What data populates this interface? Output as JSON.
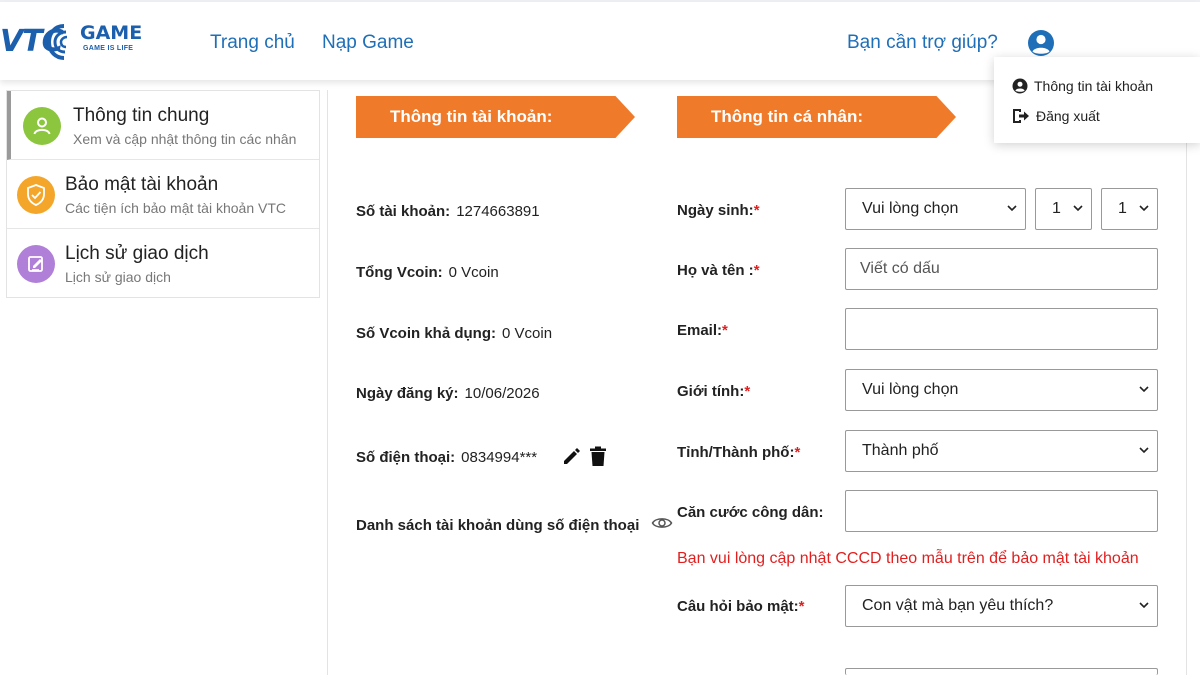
{
  "header": {
    "logo": {
      "brand": "VTC",
      "game": "GAME",
      "slogan": "GAME IS LIFE"
    },
    "nav": [
      {
        "label": "Trang chủ"
      },
      {
        "label": "Nạp Game"
      }
    ],
    "help_label": "Bạn cần trợ giúp?"
  },
  "dropdown": {
    "items": [
      {
        "label": "Thông tin tài khoản",
        "icon": "user-circle-icon"
      },
      {
        "label": "Đăng xuất",
        "icon": "logout-icon"
      }
    ]
  },
  "sidebar": {
    "items": [
      {
        "title": "Thông tin chung",
        "subtitle": "Xem và cập nhật thông tin các nhân",
        "icon": "user-icon",
        "color": "#8cc63f"
      },
      {
        "title": "Bảo mật tài khoản",
        "subtitle": "Các tiện ích bảo mật tài khoản VTC",
        "icon": "shield-check-icon",
        "color": "#f4a62a"
      },
      {
        "title": "Lịch sử giao dịch",
        "subtitle": "Lịch sử giao dịch",
        "icon": "edit-note-icon",
        "color": "#b07fd8"
      }
    ]
  },
  "account": {
    "heading": "Thông tin tài khoản:",
    "fields": [
      {
        "label": "Số tài khoản:",
        "value": "1274663891"
      },
      {
        "label": "Tổng Vcoin:",
        "value": "0 Vcoin"
      },
      {
        "label": "Số Vcoin khả dụng:",
        "value": "0 Vcoin"
      },
      {
        "label": "Ngày đăng ký:",
        "value": "10/06/2026"
      },
      {
        "label": "Số điện thoại:",
        "value": "0834994***"
      }
    ],
    "phone_accounts_label": "Danh sách tài khoản dùng số điện thoại"
  },
  "personal": {
    "heading": "Thông tin cá nhân:",
    "birthday": {
      "label": "Ngày sinh:",
      "select": "Vui lòng chọn",
      "day": "1",
      "month": "1"
    },
    "fullname": {
      "label": "Họ và tên :",
      "placeholder": "Viết có dấu"
    },
    "email": {
      "label": "Email:",
      "value": ""
    },
    "gender": {
      "label": "Giới tính:",
      "select": "Vui lòng chọn"
    },
    "city": {
      "label": "Tỉnh/Thành phố:",
      "select": "Thành phố"
    },
    "id_card": {
      "label": "Căn cước công dân:",
      "value": ""
    },
    "id_note": "Bạn vui lòng cập nhật CCCD theo mẫu trên để bảo mật tài khoản",
    "security_question": {
      "label": "Câu hỏi bảo mật:",
      "select": "Con vật mà bạn yêu thích?"
    },
    "required_mark": "*"
  },
  "colors": {
    "accent": "#ee7a2a",
    "link": "#1f6fb8",
    "required": "#e21f1f"
  }
}
